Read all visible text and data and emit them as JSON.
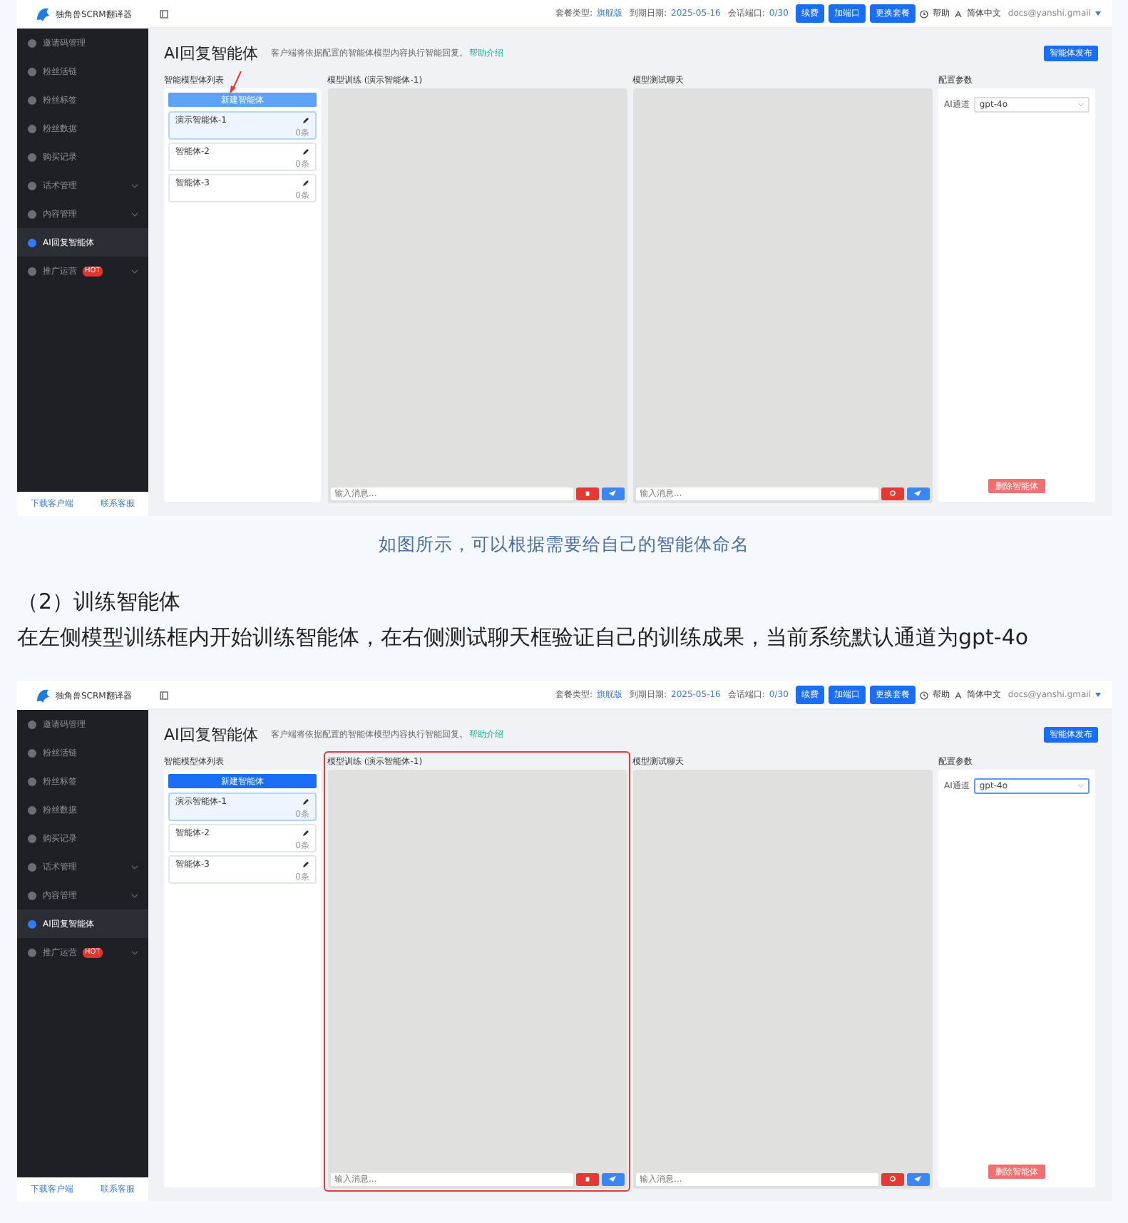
{
  "figure_1": {
    "logo_text": "独角兽SCRM翻译器",
    "header": {
      "plan_label": "套餐类型:",
      "plan": "旗舰版",
      "expiry_label": "到期日期:",
      "expiry": "2025-05-16",
      "ports_label": "会话端口:",
      "ports": "0/30",
      "buttons": [
        "续费",
        "加端口",
        "更换套餐"
      ],
      "help": "帮助",
      "language": "简体中文",
      "account": "docs@yanshi.gmail"
    },
    "sidebar": {
      "items": [
        {
          "label": "邀请码管理",
          "selected": false,
          "expandable": false
        },
        {
          "label": "粉丝活链",
          "selected": false,
          "expandable": false
        },
        {
          "label": "粉丝标签",
          "selected": false,
          "expandable": false
        },
        {
          "label": "粉丝数据",
          "selected": false,
          "expandable": false
        },
        {
          "label": "购买记录",
          "selected": false,
          "expandable": false
        },
        {
          "label": "话术管理",
          "selected": false,
          "expandable": true
        },
        {
          "label": "内容管理",
          "selected": false,
          "expandable": true
        },
        {
          "label": "AI回复智能体",
          "selected": true,
          "expandable": false
        },
        {
          "label": "推广运营",
          "selected": false,
          "expandable": true,
          "badge": "HOT"
        }
      ],
      "footer_links": [
        "下载客户端",
        "联系客服"
      ]
    },
    "title": "AI回复智能体",
    "subtitle": "客户端将依据配置的智能体模型内容执行智能回复。",
    "help_link": "帮助介绍",
    "publish_button": "智能体发布",
    "agent_list": {
      "title": "智能模型体列表",
      "new_button": "新建智能体",
      "new_button_faded": true,
      "agents": [
        {
          "name": "演示智能体-1",
          "count": "0条",
          "selected": true
        },
        {
          "name": "智能体-2",
          "count": "0条",
          "selected": false
        },
        {
          "name": "智能体-3",
          "count": "0条",
          "selected": false
        }
      ]
    },
    "training": {
      "title": "模型训练 (演示智能体-1)",
      "placeholder": "输入消息...",
      "highlighted": false
    },
    "test_chat": {
      "title": "模型测试聊天",
      "placeholder": "输入消息..."
    },
    "config": {
      "title": "配置参数",
      "channel_label": "AI通道",
      "channel": "gpt-4o",
      "channel_focused": false,
      "delete_button": "删除智能体"
    },
    "annotation_arrow": true
  },
  "caption": "如图所示，可以根据需要给自己的智能体命名",
  "heading": "（2）训练智能体",
  "paragraph": "在左侧模型训练框内开始训练智能体，在右侧测试聊天框验证自己的训练成果，当前系统默认通道为gpt-4o",
  "figure_2": {
    "logo_text": "独角兽SCRM翻译器",
    "header": {
      "plan_label": "套餐类型:",
      "plan": "旗舰版",
      "expiry_label": "到期日期:",
      "expiry": "2025-05-16",
      "ports_label": "会话端口:",
      "ports": "0/30",
      "buttons": [
        "续费",
        "加端口",
        "更换套餐"
      ],
      "help": "帮助",
      "language": "简体中文",
      "account": "docs@yanshi.gmail"
    },
    "sidebar": {
      "items": [
        {
          "label": "邀请码管理",
          "selected": false,
          "expandable": false
        },
        {
          "label": "粉丝活链",
          "selected": false,
          "expandable": false
        },
        {
          "label": "粉丝标签",
          "selected": false,
          "expandable": false
        },
        {
          "label": "粉丝数据",
          "selected": false,
          "expandable": false
        },
        {
          "label": "购买记录",
          "selected": false,
          "expandable": false
        },
        {
          "label": "话术管理",
          "selected": false,
          "expandable": true
        },
        {
          "label": "内容管理",
          "selected": false,
          "expandable": true
        },
        {
          "label": "AI回复智能体",
          "selected": true,
          "expandable": false
        },
        {
          "label": "推广运营",
          "selected": false,
          "expandable": true,
          "badge": "HOT"
        }
      ],
      "footer_links": [
        "下载客户端",
        "联系客服"
      ]
    },
    "title": "AI回复智能体",
    "subtitle": "客户端将依据配置的智能体模型内容执行智能回复。",
    "help_link": "帮助介绍",
    "publish_button": "智能体发布",
    "agent_list": {
      "title": "智能模型体列表",
      "new_button": "新建智能体",
      "new_button_faded": false,
      "agents": [
        {
          "name": "演示智能体-1",
          "count": "0条",
          "selected": true
        },
        {
          "name": "智能体-2",
          "count": "0条",
          "selected": false
        },
        {
          "name": "智能体-3",
          "count": "0条",
          "selected": false
        }
      ]
    },
    "training": {
      "title": "模型训练 (演示智能体-1)",
      "placeholder": "输入消息...",
      "highlighted": true
    },
    "test_chat": {
      "title": "模型测试聊天",
      "placeholder": "输入消息..."
    },
    "config": {
      "title": "配置参数",
      "channel_label": "AI通道",
      "channel": "gpt-4o",
      "channel_focused": true,
      "delete_button": "删除智能体"
    },
    "annotation_arrow": false
  }
}
